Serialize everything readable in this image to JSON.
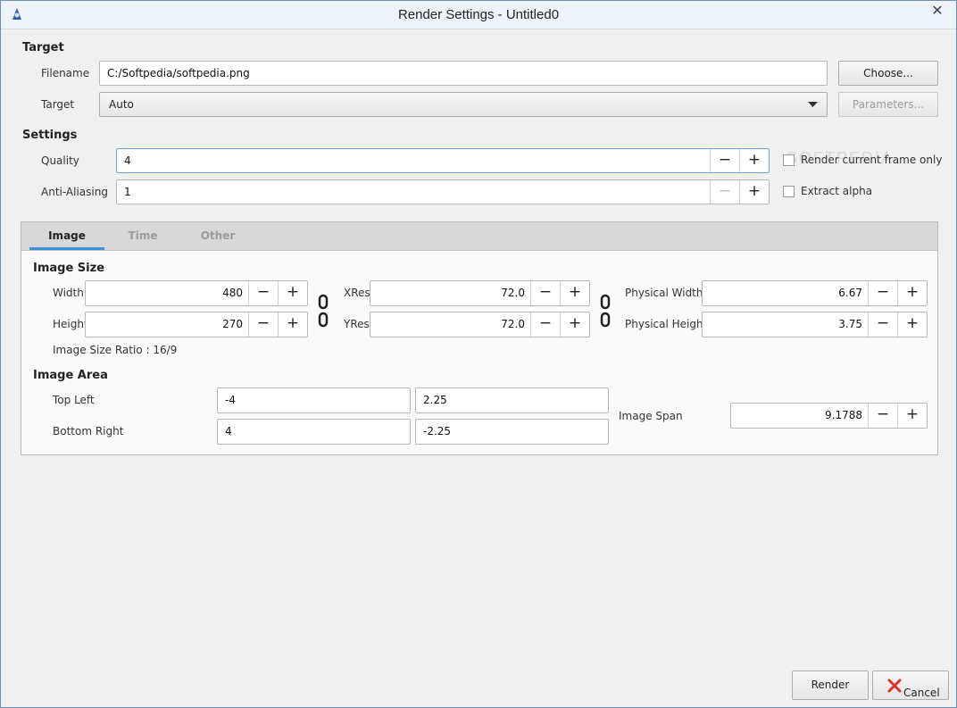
{
  "window": {
    "title": "Render Settings - Untitled0",
    "close_glyph": "✕"
  },
  "target": {
    "section": "Target",
    "filename_label": "Filename",
    "filename_value": "C:/Softpedia/softpedia.png",
    "choose_button": "Choose...",
    "target_label": "Target",
    "target_value": "Auto",
    "parameters_button": "Parameters..."
  },
  "settings": {
    "section": "Settings",
    "quality_label": "Quality",
    "quality_value": "4",
    "antialias_label": "Anti-Aliasing",
    "antialias_value": "1",
    "render_current_frame": "Render current frame only",
    "extract_alpha": "Extract alpha",
    "render_current_frame_checked": false,
    "extract_alpha_checked": false
  },
  "watermark": "SOFTPEDIA",
  "tabs": [
    {
      "label": "Image",
      "active": true
    },
    {
      "label": "Time",
      "active": false
    },
    {
      "label": "Other",
      "active": false
    }
  ],
  "image_size": {
    "section": "Image Size",
    "width_label": "Width",
    "width_value": "480",
    "height_label": "Height",
    "height_value": "270",
    "xres_label": "XRes",
    "xres_value": "72.0",
    "yres_label": "YRes",
    "yres_value": "72.0",
    "pwidth_label": "Physical Width",
    "pwidth_value": "6.67",
    "pheight_label": "Physical Height",
    "pheight_value": "3.75",
    "ratio_text": "Image Size Ratio : 16/9"
  },
  "image_area": {
    "section": "Image Area",
    "top_left_label": "Top Left",
    "top_left_x": "-4",
    "top_left_y": "2.25",
    "bottom_right_label": "Bottom Right",
    "bottom_right_x": "4",
    "bottom_right_y": "-2.25",
    "span_label": "Image Span",
    "span_value": "9.1788"
  },
  "spin": {
    "minus": "−",
    "plus": "+"
  },
  "footer": {
    "render_button": "Render",
    "cancel_button": "Cancel"
  },
  "colors": {
    "accent": "#3c8fd8",
    "cancel_x": "#d9302c"
  }
}
